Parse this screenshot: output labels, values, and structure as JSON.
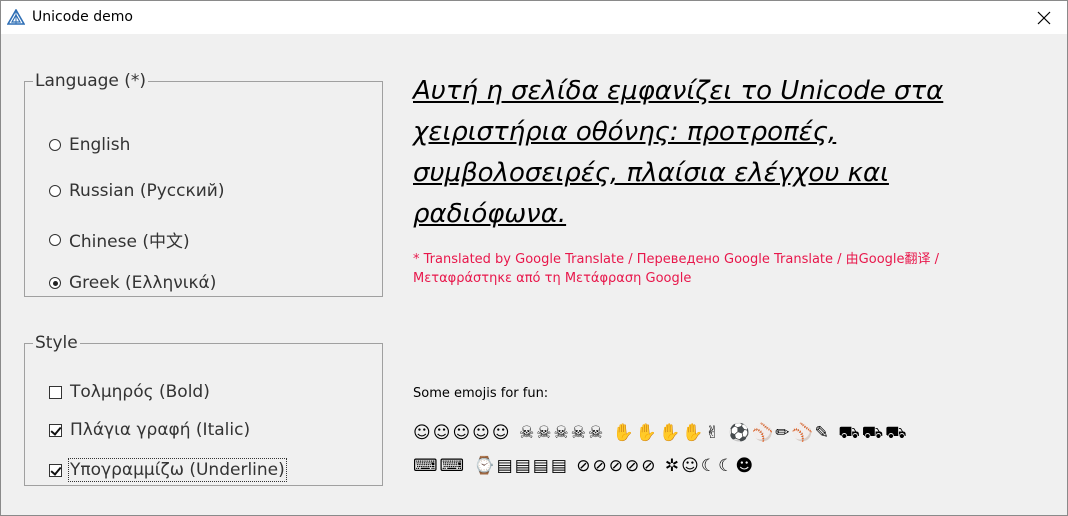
{
  "window": {
    "title": "Unicode demo"
  },
  "language_group": {
    "legend": "Language (*)",
    "options": [
      {
        "label": "English",
        "checked": false
      },
      {
        "label": "Russian (Русский)",
        "checked": false
      },
      {
        "label": "Chinese (中文)",
        "checked": false
      },
      {
        "label": "Greek (Ελληνικά)",
        "checked": true
      }
    ]
  },
  "style_group": {
    "legend": "Style",
    "options": [
      {
        "label": "Τολμηρός (Bold)",
        "checked": false
      },
      {
        "label": "Πλάγια γραφή (Italic)",
        "checked": true
      },
      {
        "label": "Υπογραμμίζω (Underline)",
        "checked": true,
        "focused": true
      }
    ]
  },
  "main": {
    "text": "Αυτή η σελίδα εμφανίζει το Unicode στα χειριστήρια οθόνης: προτροπές, συμβολοσειρές, πλαίσια ελέγχου και ραδιόφωνα.",
    "note": "* Translated by Google Translate / Переведено Google Translate / 由Google翻译 / Μεταφράστηκε από τη Μετάφραση Google",
    "emoji_label": "Some emojis for fun:",
    "emoji_rows": [
      "☺☺☺☺☺ ☠☠☠☠☠ ✋✋✋✋✌ ⚽⚾✏⚾✎ ⛟⛟⛟",
      "⌨⌨ ⌚▤▤▤▤ ⊘⊘⊘⊘⊘ ✲☺☾☾☻"
    ]
  },
  "colors": {
    "note": "#e8174b",
    "frame": "#a0a0a0",
    "background": "#f0f0f0"
  }
}
